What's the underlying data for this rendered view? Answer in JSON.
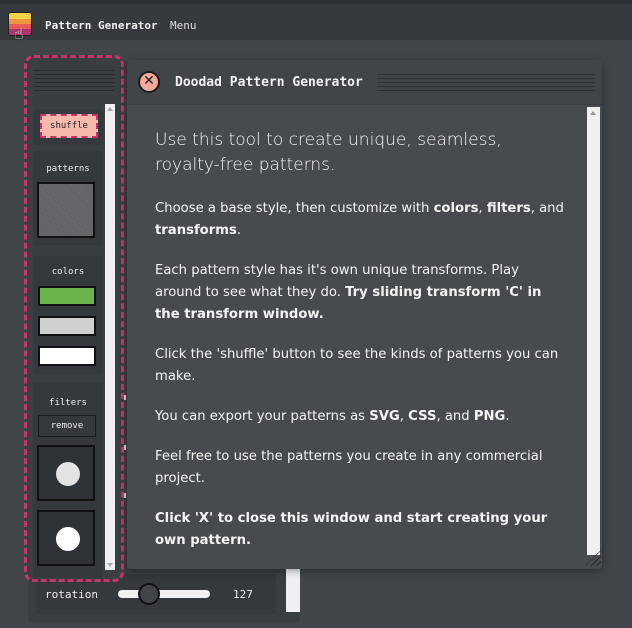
{
  "app": {
    "title": "Pattern Generator",
    "menu_label": "Menu",
    "logo_icon": "pattern-logo-icon"
  },
  "tools": {
    "shuffle_label": "shuffle",
    "patterns_label": "patterns",
    "colors_label": "colors",
    "filters_label": "filters",
    "remove_label": "remove",
    "color_swatches": [
      "#6bb34a",
      "#d0d0d0",
      "#ffffff"
    ],
    "filter_dot_colors": [
      "#e3e3e3",
      "#ffffff"
    ]
  },
  "rotation": {
    "label": "rotation",
    "value": "127"
  },
  "dialog": {
    "title": "Doodad Pattern Generator",
    "close_symbol": "✕",
    "lead": "Use this tool to create unique, seamless, royalty-free patterns.",
    "p1_a": "Choose a base style, then customize with ",
    "p1_b": "colors",
    "p1_c": ", ",
    "p1_d": "filters",
    "p1_e": ", and ",
    "p1_f": "transforms",
    "p1_g": ".",
    "p2_a": "Each pattern style has it's own unique transforms. Play around to see what they do. ",
    "p2_b": "Try sliding transform 'C' in the transform window.",
    "p3": "Click the 'shuffle' button to see the kinds of patterns you can make.",
    "p4_a": "You can export your patterns as ",
    "p4_b": "SVG",
    "p4_c": ", ",
    "p4_d": "CSS",
    "p4_e": ", and ",
    "p4_f": "PNG",
    "p4_g": ".",
    "p5": "Feel free to use the patterns you create in any commercial project.",
    "p6": "Click 'X' to close this window and start creating your own pattern."
  },
  "colors": {
    "accent_dashed": "#c8336a",
    "shuffle_bg": "#f7b9ab",
    "close_bg": "#f5a99d"
  }
}
